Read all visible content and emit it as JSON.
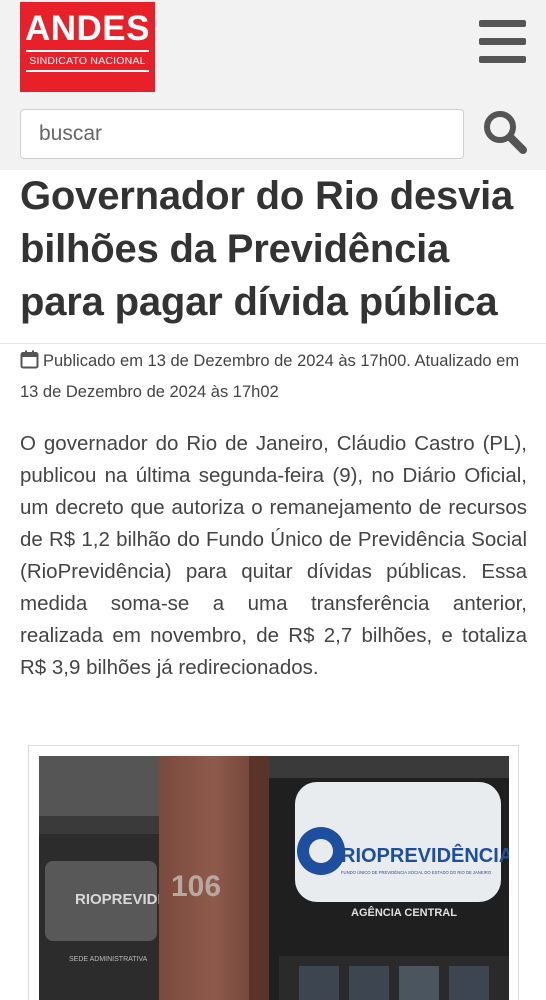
{
  "header": {
    "logo": {
      "title": "ANDES",
      "subtitle": "SINDICATO NACIONAL"
    },
    "search": {
      "placeholder": "buscar"
    }
  },
  "article": {
    "title": "Governador do Rio desvia bilhões da Previdência para pagar dívida pública",
    "meta": "Publicado em 13 de Dezembro de 2024 às 17h00. Atualizado em 13 de Dezembro de 2024 às 17h02",
    "body": "O governador do Rio de Janeiro, Cláudio Castro (PL), publicou na última segunda-feira (9), no Diário Oficial, um decreto que autoriza o remanejamento de recursos de R$ 1,2 bilhão do Fundo Único de Previdência Social (RioPrevidência) para quitar dívidas públicas. Essa medida soma-se a uma transferência anterior, realizada em novembro, de R$ 2,7 bilhões, e totaliza R$ 3,9 bilhões já redirecionados.",
    "photo": {
      "sign_main": "RIOPREVIDÊNCIA",
      "sign_small": "FUNDO ÚNICO DE PREVIDÊNCIA SOCIAL DO ESTADO DO RIO DE JANEIRO",
      "sign_agency": "AGÊNCIA CENTRAL",
      "sign_left": "RIOPREVIDÊNCIA",
      "sign_left_small": "SEDE ADMINISTRATIVA",
      "building_number": "106"
    }
  },
  "colors": {
    "brand_red": "#e8202a",
    "header_bg": "#f2f2f2",
    "text": "#333333"
  },
  "icons": {
    "menu": "hamburger-menu-icon",
    "search": "search-icon",
    "calendar": "calendar-icon"
  }
}
